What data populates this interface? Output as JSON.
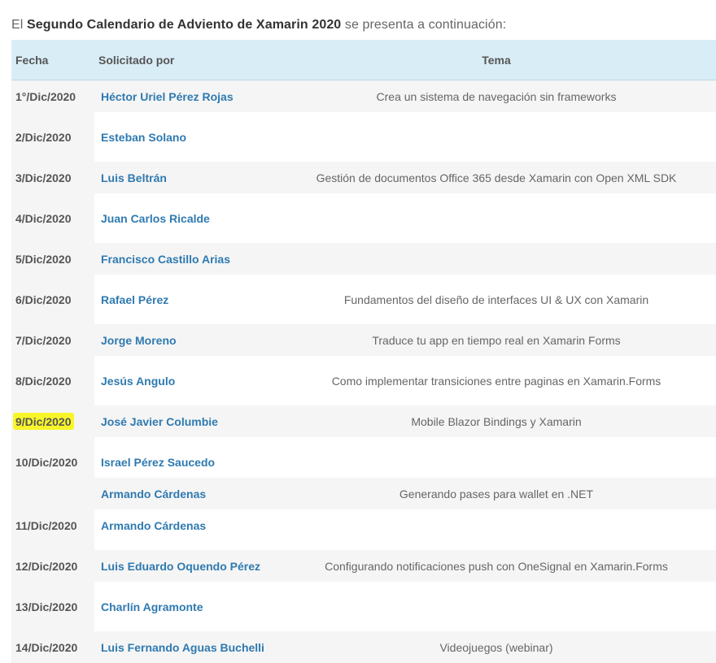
{
  "intro": {
    "prefix": "El ",
    "bold": "Segundo Calendario de Adviento de Xamarin 2020",
    "suffix": " se presenta a continuación:"
  },
  "table": {
    "headers": [
      "Fecha",
      "Solicitado por",
      "Tema"
    ],
    "rows": [
      {
        "date": "1°/Dic/2020",
        "name": "Héctor Uriel Pérez Rojas",
        "topic": "Crea un sistema de navegación sin frameworks"
      },
      {
        "date": "2/Dic/2020",
        "name": "Esteban Solano",
        "topic": ""
      },
      {
        "date": "3/Dic/2020",
        "name": "Luis Beltrán",
        "topic": "Gestión de documentos Office 365 desde Xamarin con Open XML SDK"
      },
      {
        "date": "4/Dic/2020",
        "name": "Juan Carlos Ricalde",
        "topic": ""
      },
      {
        "date": "5/Dic/2020",
        "name": "Francisco Castillo Arias",
        "topic": ""
      },
      {
        "date": "6/Dic/2020",
        "name": "Rafael Pérez",
        "topic": "Fundamentos del diseño de interfaces UI & UX con Xamarin"
      },
      {
        "date": "7/Dic/2020",
        "name": "Jorge Moreno",
        "topic": "Traduce tu app en tiempo real en Xamarin Forms"
      },
      {
        "date": "8/Dic/2020",
        "name": "Jesús Angulo",
        "topic": "Como implementar transiciones entre paginas en Xamarin.Forms"
      },
      {
        "date": "9/Dic/2020",
        "name": "José Javier Columbie",
        "topic": "Mobile Blazor Bindings y Xamarin"
      },
      {
        "date": "10/Dic/2020",
        "name": "Israel Pérez Saucedo",
        "topic": ""
      },
      {
        "date": "",
        "name": "Armando Cárdenas",
        "topic": "Generando pases para wallet en .NET"
      },
      {
        "date": "11/Dic/2020",
        "name": "Armando Cárdenas",
        "topic": ""
      },
      {
        "date": "12/Dic/2020",
        "name": "Luis Eduardo Oquendo Pérez",
        "topic": "Configurando notificaciones push con OneSignal en Xamarin.Forms"
      },
      {
        "date": "13/Dic/2020",
        "name": "Charlín Agramonte",
        "topic": ""
      },
      {
        "date": "14/Dic/2020",
        "name": "Luis Fernando Aguas Buchelli",
        "topic": "Videojuegos (webinar)"
      }
    ]
  },
  "highlight_color": "#f8f52a",
  "link_color": "#2f7ab0"
}
